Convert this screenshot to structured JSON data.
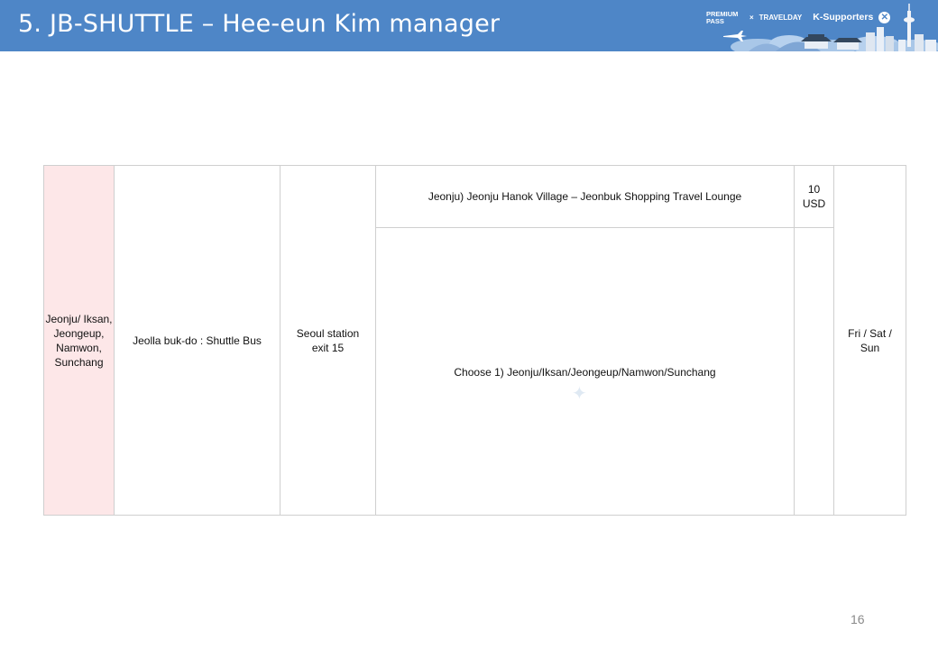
{
  "header": {
    "title": "5. JB-SHUTTLE – Hee-eun Kim manager",
    "brand": {
      "premium_pass": "PREMIUM PASS",
      "separator": "×",
      "travelday": "TRAVELDAY",
      "k_supporters": "K-Supporters",
      "badge_icon": "close-circle-icon"
    },
    "colors": {
      "bar": "#4e86c7"
    }
  },
  "table": {
    "region": "Jeonju/ Iksan, Jeongeup, Namwon, Sunchang",
    "service": "Jeolla buk-do : Shuttle Bus",
    "departure": "Seoul station exit 15",
    "routes": [
      {
        "detail": "Jeonju) Jeonju Hanok Village – Jeonbuk Shopping Travel Lounge",
        "price": "10 USD"
      },
      {
        "detail": "Choose 1) Jeonju/Iksan/Jeongeup/Namwon/Sunchang",
        "price": ""
      }
    ],
    "days": "Fri / Sat / Sun",
    "colors": {
      "region_bg": "#fde7e8",
      "border": "#cfcfcf"
    }
  },
  "footer": {
    "page_number": "16"
  }
}
